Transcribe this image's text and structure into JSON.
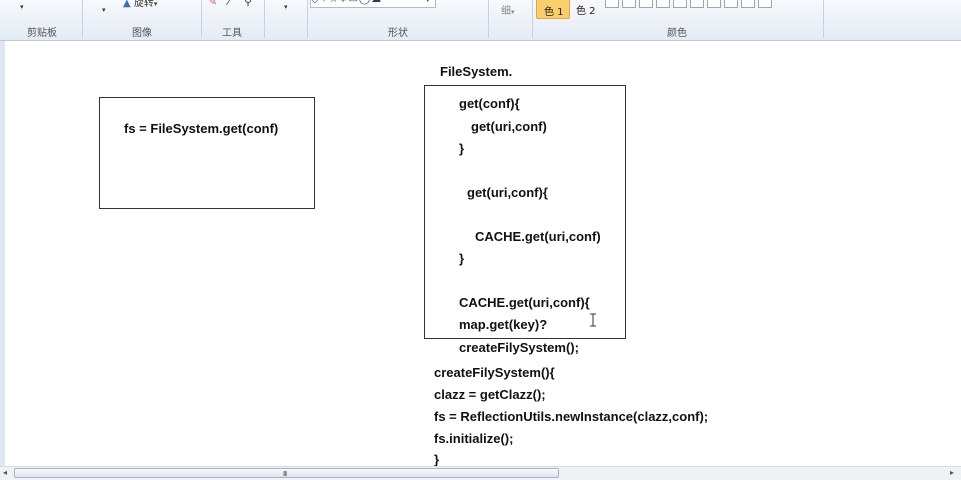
{
  "ribbon": {
    "groups": {
      "clipboard": "剪贴板",
      "image": "图像",
      "tools": "工具",
      "shapes": "形状",
      "colors": "颜色"
    },
    "rotate_label": "旋转",
    "thin_label": "细",
    "color1_label": "色 1",
    "color2_label": "色 2",
    "color1_value": "#f5c14a"
  },
  "canvas": {
    "left_box_text": "fs = FileSystem.get(conf)",
    "title": "FileSystem.",
    "box_lines": [
      "get(conf){",
      "get(uri,conf)",
      "}",
      "get(uri,conf){",
      "CACHE.get(uri,conf)",
      "}",
      "CACHE.get(uri,conf){",
      "map.get(key)?"
    ],
    "below_lines": [
      "createFilySystem();",
      "createFilySystem(){",
      "clazz = getClazz();",
      "fs = ReflectionUtils.newInstance(clazz,conf);",
      "fs.initialize();",
      "}"
    ]
  },
  "scrollbar": {
    "grip": "III"
  }
}
